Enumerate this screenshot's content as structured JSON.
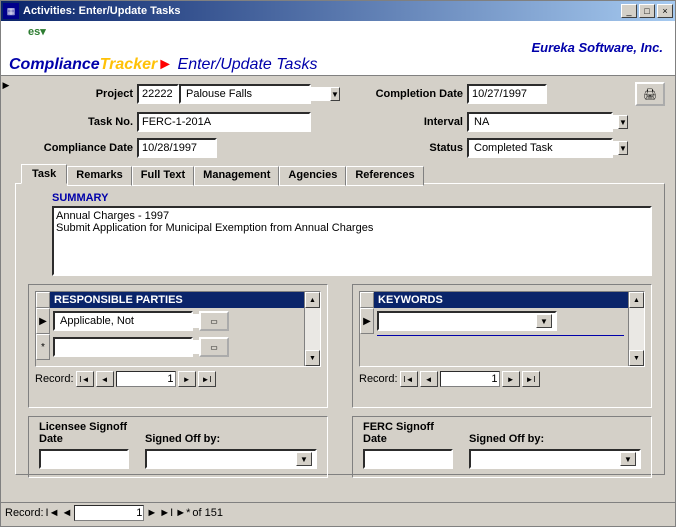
{
  "window": {
    "title": "Activities: Enter/Update Tasks"
  },
  "header": {
    "page_title": "Enter/Update Tasks",
    "company": "Eureka Software, Inc.",
    "logo_compliance": "Compliance",
    "logo_tracker": "Tracker",
    "badge": "es▾"
  },
  "fields": {
    "project_label": "Project",
    "project_code": "22222",
    "project_name": "Palouse Falls",
    "taskno_label": "Task No.",
    "taskno": "FERC-1-201A",
    "compliance_date_label": "Compliance Date",
    "compliance_date": "10/28/1997",
    "completion_date_label": "Completion Date",
    "completion_date": "10/27/1997",
    "interval_label": "Interval",
    "interval": "NA",
    "status_label": "Status",
    "status": "Completed Task"
  },
  "tabs": {
    "task": "Task",
    "remarks": "Remarks",
    "fulltext": "Full Text",
    "management": "Management",
    "agencies": "Agencies",
    "references": "References"
  },
  "summary": {
    "label": "SUMMARY",
    "line1": "Annual Charges - 1997",
    "line2": "Submit Application for Municipal Exemption from Annual Charges"
  },
  "parties": {
    "header": "RESPONSIBLE PARTIES",
    "row1": "Applicable, Not",
    "row2": "",
    "record_label": "Record:",
    "record_pos": "1"
  },
  "keywords": {
    "header": "KEYWORDS",
    "row1": "",
    "record_label": "Record:",
    "record_pos": "1"
  },
  "signoff": {
    "licensee_date_label": "Licensee Signoff Date",
    "licensee_date": "",
    "licensee_by_label": "Signed Off by:",
    "licensee_by": "",
    "ferc_date_label": "FERC Signoff Date",
    "ferc_date": "",
    "ferc_by_label": "Signed Off by:",
    "ferc_by": ""
  },
  "footer": {
    "record_label": "Record:",
    "record_pos": "1",
    "record_total": " of  151"
  }
}
